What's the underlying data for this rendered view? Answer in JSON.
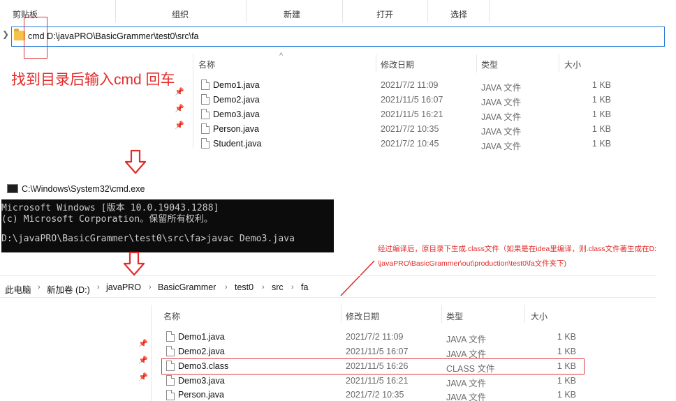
{
  "ribbon": {
    "groups": [
      "剪贴板",
      "组织",
      "新建",
      "打开",
      "选择"
    ]
  },
  "address_bar": {
    "value": "cmd D:\\javaPRO\\BasicGrammer\\test0\\src\\fa"
  },
  "instruction_note": "找到目录后输入cmd 回车",
  "columns": {
    "name": "名称",
    "modified": "修改日期",
    "type": "类型",
    "size": "大小"
  },
  "top_files": [
    {
      "name": "Demo1.java",
      "modified": "2021/7/2 11:09",
      "type": "JAVA 文件",
      "size": "1 KB"
    },
    {
      "name": "Demo2.java",
      "modified": "2021/11/5 16:07",
      "type": "JAVA 文件",
      "size": "1 KB"
    },
    {
      "name": "Demo3.java",
      "modified": "2021/11/5 16:21",
      "type": "JAVA 文件",
      "size": "1 KB"
    },
    {
      "name": "Person.java",
      "modified": "2021/7/2 10:35",
      "type": "JAVA 文件",
      "size": "1 KB"
    },
    {
      "name": "Student.java",
      "modified": "2021/7/2 10:45",
      "type": "JAVA 文件",
      "size": "1 KB"
    }
  ],
  "cmd": {
    "title": "C:\\Windows\\System32\\cmd.exe",
    "lines": [
      "Microsoft Windows [版本 10.0.19043.1288]",
      "(c) Microsoft Corporation。保留所有权利。",
      "",
      "D:\\javaPRO\\BasicGrammer\\test0\\src\\fa>javac Demo3.java"
    ]
  },
  "annotation": {
    "line1": "经过编译后，原目录下生成.class文件（如果是在idea里编译，则.class文件著生成在D:",
    "line2": "\\javaPRO\\BasicGrammer\\out\\production\\test0\\fa文件夹下)"
  },
  "breadcrumb": [
    "此电脑",
    "新加卷 (D:)",
    "javaPRO",
    "BasicGrammer",
    "test0",
    "src",
    "fa"
  ],
  "bottom_files": [
    {
      "name": "Demo1.java",
      "modified": "2021/7/2 11:09",
      "type": "JAVA 文件",
      "size": "1 KB"
    },
    {
      "name": "Demo2.java",
      "modified": "2021/11/5 16:07",
      "type": "JAVA 文件",
      "size": "1 KB"
    },
    {
      "name": "Demo3.class",
      "modified": "2021/11/5 16:26",
      "type": "CLASS 文件",
      "size": "1 KB"
    },
    {
      "name": "Demo3.java",
      "modified": "2021/11/5 16:21",
      "type": "JAVA 文件",
      "size": "1 KB"
    },
    {
      "name": "Person.java",
      "modified": "2021/7/2 10:35",
      "type": "JAVA 文件",
      "size": "1 KB"
    }
  ],
  "colors": {
    "annotation_red": "#e32b2b",
    "address_border": "#2b7bd6",
    "cmd_background": "#0c0c0c"
  }
}
